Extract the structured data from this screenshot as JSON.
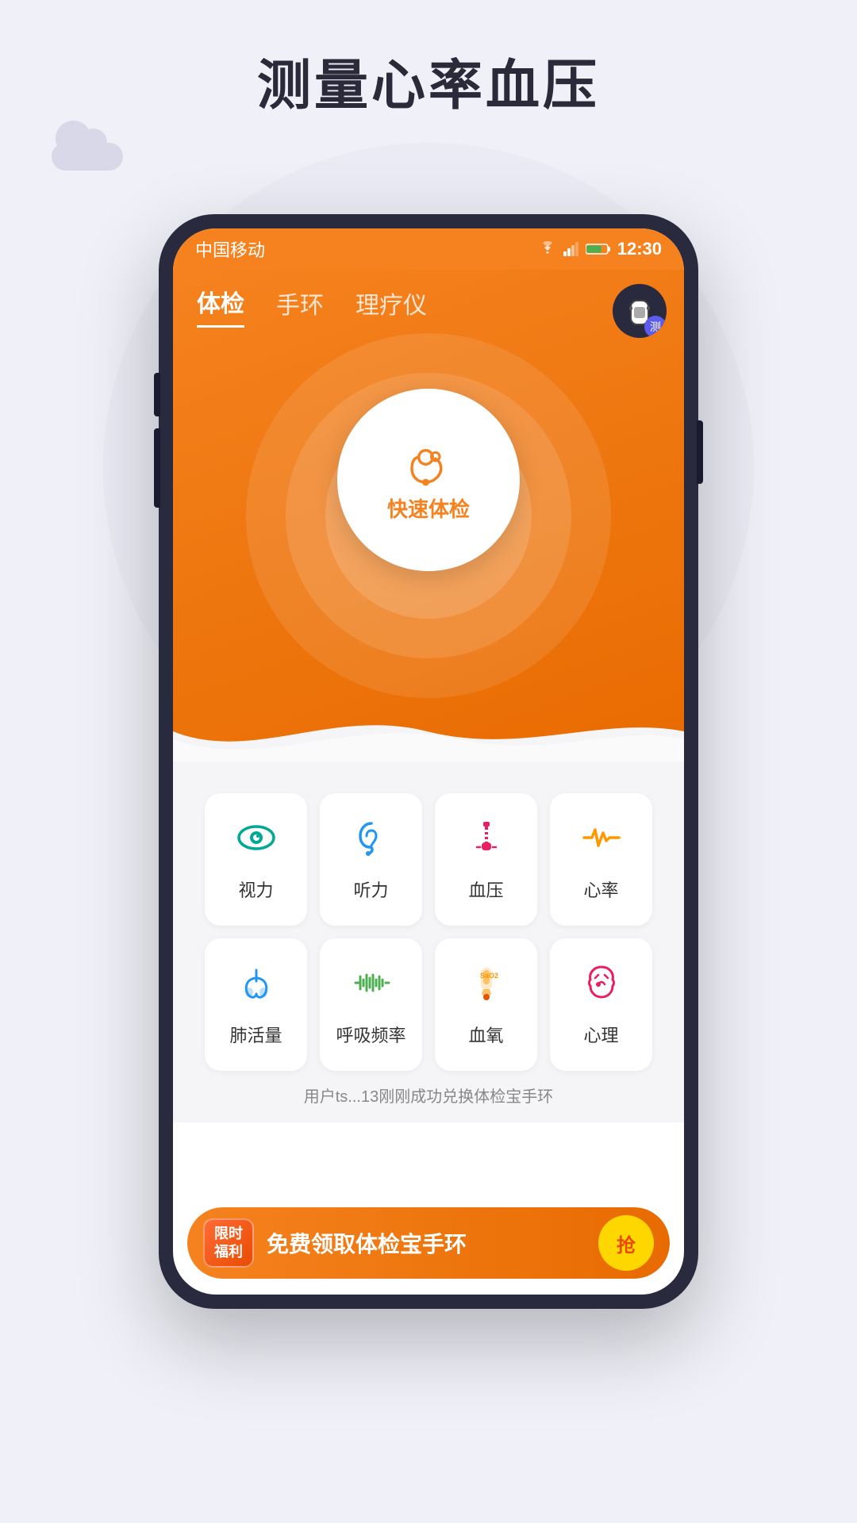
{
  "page": {
    "title": "测量心率血压",
    "background_color": "#f0f0f8"
  },
  "status_bar": {
    "carrier": "中国移动",
    "time": "12:30",
    "battery_color": "#4caf50"
  },
  "nav": {
    "tabs": [
      {
        "label": "体检",
        "active": true
      },
      {
        "label": "手环",
        "active": false
      },
      {
        "label": "理疗仪",
        "active": false
      }
    ]
  },
  "center_button": {
    "label": "快速体检"
  },
  "wearable_badge": {
    "label": "测"
  },
  "health_items_row1": [
    {
      "label": "视力",
      "icon": "eye",
      "color": "#00a896"
    },
    {
      "label": "听力",
      "icon": "ear",
      "color": "#2196f3"
    },
    {
      "label": "血压",
      "icon": "thermometer",
      "color": "#e91e63"
    },
    {
      "label": "心率",
      "icon": "heartrate",
      "color": "#ff9800"
    }
  ],
  "health_items_row2": [
    {
      "label": "肺活量",
      "icon": "lungs",
      "color": "#2196f3"
    },
    {
      "label": "呼吸频率",
      "icon": "breath",
      "color": "#4caf50"
    },
    {
      "label": "血氧",
      "icon": "blood-oxygen",
      "color": "#ff9800"
    },
    {
      "label": "心理",
      "icon": "brain",
      "color": "#e91e63"
    }
  ],
  "notification": {
    "text": "用户ts...13刚刚成功兑换体检宝手环"
  },
  "banner": {
    "tag_line1": "限时",
    "tag_line2": "福利",
    "text": "免费领取体检宝手环",
    "button_label": "抢"
  }
}
